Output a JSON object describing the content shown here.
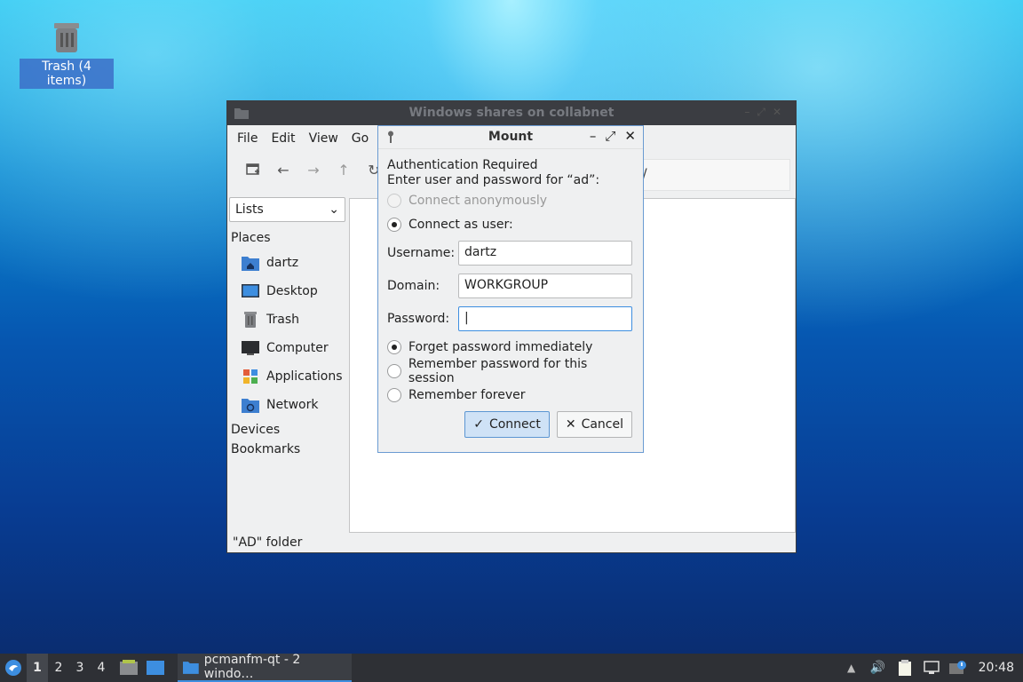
{
  "desktop": {
    "trash_label": "Trash (4 items)"
  },
  "window": {
    "title": "Windows shares on collabnet",
    "menu": [
      "File",
      "Edit",
      "View",
      "Go"
    ],
    "path_fragment": "t/",
    "side_view_mode": "Lists",
    "places_header": "Places",
    "places": [
      "dartz",
      "Desktop",
      "Trash",
      "Computer",
      "Applications",
      "Network"
    ],
    "devices_header": "Devices",
    "bookmarks_header": "Bookmarks",
    "status": "\"AD\" folder"
  },
  "dialog": {
    "title": "Mount",
    "auth_line1": "Authentication Required",
    "auth_line2": "Enter user and password for “ad”:",
    "connect_anonymously": "Connect anonymously",
    "connect_as_user": "Connect as user:",
    "username_label": "Username:",
    "username_value": "dartz",
    "domain_label": "Domain:",
    "domain_value": "WORKGROUP",
    "password_label": "Password:",
    "password_value": "",
    "forget_password": "Forget password immediately",
    "remember_session": "Remember password for this session",
    "remember_forever": "Remember forever",
    "connect_button": "Connect",
    "cancel_button": "Cancel"
  },
  "taskbar": {
    "workspaces": [
      "1",
      "2",
      "3",
      "4"
    ],
    "task_label": "pcmanfm-qt - 2 windo…",
    "clock": "20:48"
  },
  "colors": {
    "accent": "#3d8ee0",
    "titlebar": "#3b3d42",
    "taskbar": "#2e3035"
  }
}
